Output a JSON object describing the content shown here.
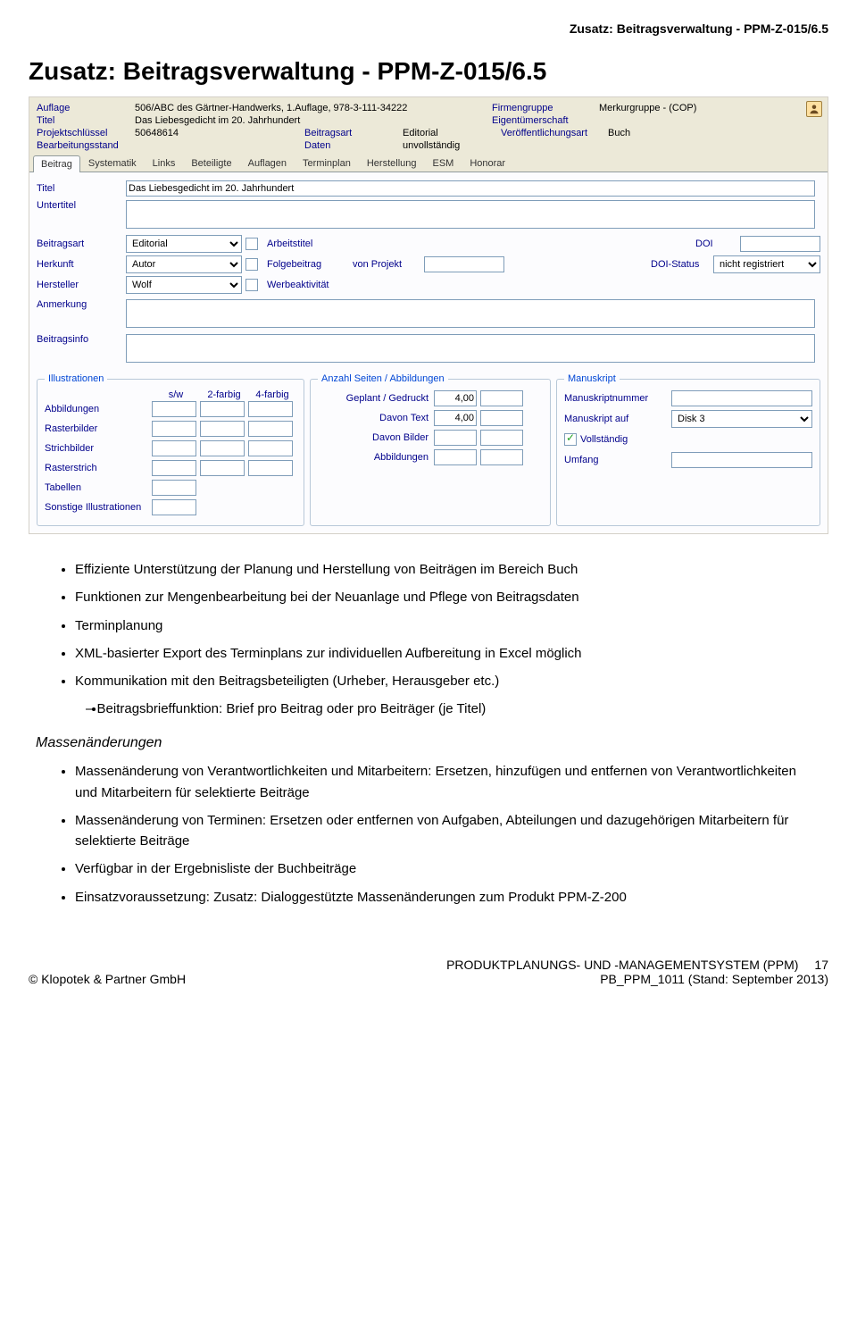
{
  "page": {
    "header_small": "Zusatz: Beitragsverwaltung - PPM-Z-015/6.5",
    "title": "Zusatz: Beitragsverwaltung - PPM-Z-015/6.5"
  },
  "header": {
    "auflage_l": "Auflage",
    "auflage_v": "506/ABC des Gärtner-Handwerks, 1.Auflage, 978-3-111-34222",
    "firmengruppe_l": "Firmengruppe",
    "firmengruppe_v": "Merkurgruppe - (COP)",
    "titel_l": "Titel",
    "titel_v": "Das Liebesgedicht im 20. Jahrhundert",
    "eigentuemer_l": "Eigentümerschaft",
    "projektschluessel_l": "Projektschlüssel",
    "projektschluessel_v": "50648614",
    "beitragsart_l": "Beitragsart",
    "beitragsart_v": "Editorial",
    "veroeff_l": "Veröffentlichungsart",
    "veroeff_v": "Buch",
    "bearb_l": "Bearbeitungsstand",
    "daten_l": "Daten",
    "daten_v": "unvollständig"
  },
  "tabs": [
    "Beitrag",
    "Systematik",
    "Links",
    "Beteiligte",
    "Auflagen",
    "Terminplan",
    "Herstellung",
    "ESM",
    "Honorar"
  ],
  "form": {
    "titel_l": "Titel",
    "titel_v": "Das Liebesgedicht im 20. Jahrhundert",
    "untertitel_l": "Untertitel",
    "untertitel_v": "",
    "beitragsart_l": "Beitragsart",
    "beitragsart_v": "Editorial",
    "arbeitstitel_l": "Arbeitstitel",
    "doi_l": "DOI",
    "doi_v": "",
    "herkunft_l": "Herkunft",
    "herkunft_v": "Autor",
    "folgebeitrag_l": "Folgebeitrag",
    "vonprojekt_l": "von Projekt",
    "vonprojekt_v": "",
    "doistatus_l": "DOI-Status",
    "doistatus_v": "nicht registriert",
    "hersteller_l": "Hersteller",
    "hersteller_v": "Wolf",
    "werbe_l": "Werbeaktivität",
    "anmerkung_l": "Anmerkung",
    "anmerkung_v": "",
    "beitragsinfo_l": "Beitragsinfo",
    "beitragsinfo_v": ""
  },
  "illus": {
    "legend": "Illustrationen",
    "cols": [
      "s/w",
      "2-farbig",
      "4-farbig"
    ],
    "rows": [
      "Abbildungen",
      "Rasterbilder",
      "Strichbilder",
      "Rasterstrich",
      "Tabellen",
      "Sonstige Illustrationen"
    ]
  },
  "anzahl": {
    "legend": "Anzahl Seiten / Abbildungen",
    "rows": [
      {
        "l": "Geplant / Gedruckt",
        "v1": "4,00",
        "v2": ""
      },
      {
        "l": "Davon Text",
        "v1": "4,00",
        "v2": ""
      },
      {
        "l": "Davon Bilder",
        "v1": "",
        "v2": ""
      },
      {
        "l": "Abbildungen",
        "v1": "",
        "v2": ""
      }
    ]
  },
  "manus": {
    "legend": "Manuskript",
    "nummer_l": "Manuskriptnummer",
    "nummer_v": "",
    "auf_l": "Manuskript auf",
    "auf_v": "Disk 3",
    "vollst_l": "Vollständig",
    "umfang_l": "Umfang",
    "umfang_v": ""
  },
  "bullets1": [
    "Effiziente Unterstützung der Planung und Herstellung von Beiträgen im Bereich Buch",
    "Funktionen zur Mengenbearbeitung bei der Neuanlage und Pflege von Beitragsdaten",
    "Terminplanung",
    "XML-basierter Export des Terminplans zur individuellen Aufbereitung in Excel möglich",
    "Kommunikation mit den Beitragsbeteiligten (Urheber, Herausgeber etc.)"
  ],
  "sub1": [
    "Beitragsbrieffunktion: Brief pro Beitrag oder pro Beiträger (je Titel)"
  ],
  "section2": "Massenänderungen",
  "bullets2": [
    "Massenänderung von Verantwortlichkeiten und Mitarbeitern: Ersetzen, hinzufügen und entfernen von Verantwortlichkeiten und Mitarbeitern für selektierte Beiträge",
    "Massenänderung von Terminen: Ersetzen oder entfernen von Aufgaben, Abteilungen und dazugehörigen Mitarbeitern für selektierte Beiträge",
    "Verfügbar in der Ergebnisliste der Buchbeiträge",
    "Einsatzvoraussetzung: Zusatz: Dialoggestützte Massenänderungen zum Produkt PPM-Z-200"
  ],
  "footer": {
    "left": "© Klopotek & Partner GmbH",
    "right1": "PRODUKTPLANUNGS- UND -MANAGEMENTSYSTEM (PPM)",
    "pageno": "17",
    "right2": "PB_PPM_1011 (Stand: September 2013)"
  }
}
